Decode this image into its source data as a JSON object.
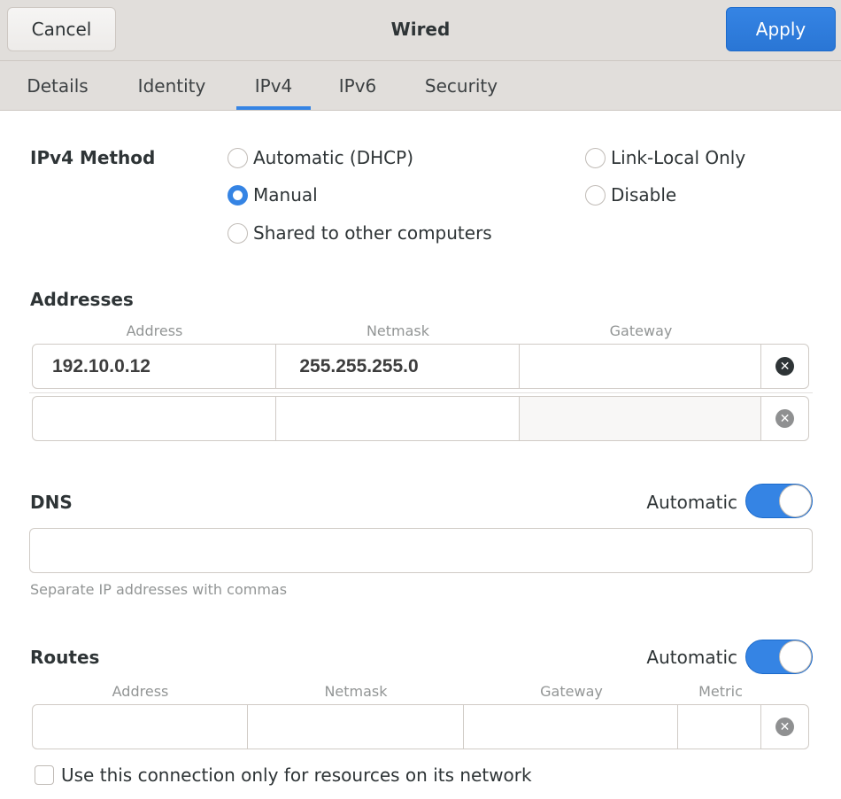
{
  "header": {
    "title": "Wired",
    "cancel_label": "Cancel",
    "apply_label": "Apply"
  },
  "tabs": [
    {
      "label": "Details",
      "active": false
    },
    {
      "label": "Identity",
      "active": false
    },
    {
      "label": "IPv4",
      "active": true
    },
    {
      "label": "IPv6",
      "active": false
    },
    {
      "label": "Security",
      "active": false
    }
  ],
  "method": {
    "label": "IPv4 Method",
    "options": [
      {
        "label": "Automatic (DHCP)",
        "checked": false
      },
      {
        "label": "Manual",
        "checked": true
      },
      {
        "label": "Shared to other computers",
        "checked": false
      },
      {
        "label": "Link-Local Only",
        "checked": false
      },
      {
        "label": "Disable",
        "checked": false
      }
    ]
  },
  "addresses": {
    "label": "Addresses",
    "columns": [
      "Address",
      "Netmask",
      "Gateway"
    ],
    "rows": [
      {
        "address": "192.10.0.12",
        "netmask": "255.255.255.0",
        "gateway": ""
      },
      {
        "address": "",
        "netmask": "",
        "gateway": ""
      }
    ]
  },
  "dns": {
    "label": "DNS",
    "automatic_label": "Automatic",
    "automatic": true,
    "value": "",
    "hint": "Separate IP addresses with commas"
  },
  "routes": {
    "label": "Routes",
    "automatic_label": "Automatic",
    "automatic": true,
    "columns": [
      "Address",
      "Netmask",
      "Gateway",
      "Metric"
    ],
    "rows": [
      {
        "address": "",
        "netmask": "",
        "gateway": "",
        "metric": ""
      }
    ]
  },
  "only_local": {
    "label": "Use this connection only for resources on its network",
    "checked": false
  },
  "colors": {
    "accent": "#3584e4",
    "header_bg": "#e1dedb"
  }
}
